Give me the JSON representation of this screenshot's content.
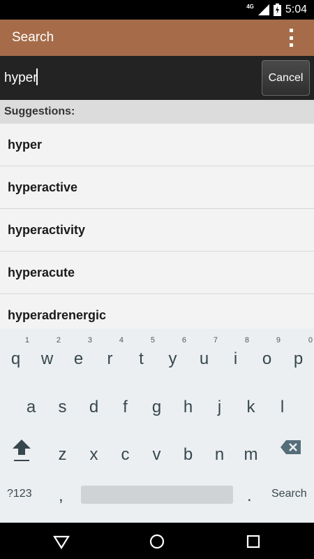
{
  "status_bar": {
    "network": "4G",
    "time": "5:04"
  },
  "app_bar": {
    "title": "Search"
  },
  "search": {
    "value": "hyper",
    "cancel_label": "Cancel"
  },
  "suggestions": {
    "header": "Suggestions:",
    "items": [
      "hyper",
      "hyperactive",
      "hyperactivity",
      "hyperacute",
      "hyperadrenergic"
    ]
  },
  "keyboard": {
    "row1": [
      {
        "ch": "q",
        "hint": "1"
      },
      {
        "ch": "w",
        "hint": "2"
      },
      {
        "ch": "e",
        "hint": "3"
      },
      {
        "ch": "r",
        "hint": "4"
      },
      {
        "ch": "t",
        "hint": "5"
      },
      {
        "ch": "y",
        "hint": "6"
      },
      {
        "ch": "u",
        "hint": "7"
      },
      {
        "ch": "i",
        "hint": "8"
      },
      {
        "ch": "o",
        "hint": "9"
      },
      {
        "ch": "p",
        "hint": "0"
      }
    ],
    "row2": [
      "a",
      "s",
      "d",
      "f",
      "g",
      "h",
      "j",
      "k",
      "l"
    ],
    "row3": [
      "z",
      "x",
      "c",
      "v",
      "b",
      "n",
      "m"
    ],
    "symbols_label": "?123",
    "comma": ",",
    "period": ".",
    "action_label": "Search"
  },
  "colors": {
    "app_bar": "#a66c49",
    "search_row": "#232323",
    "keyboard": "#eceff1"
  },
  "icons": [
    "signal-icon",
    "battery-charging-icon",
    "overflow-menu-icon",
    "shift-icon",
    "backspace-icon",
    "back-icon",
    "home-icon",
    "recents-icon"
  ]
}
